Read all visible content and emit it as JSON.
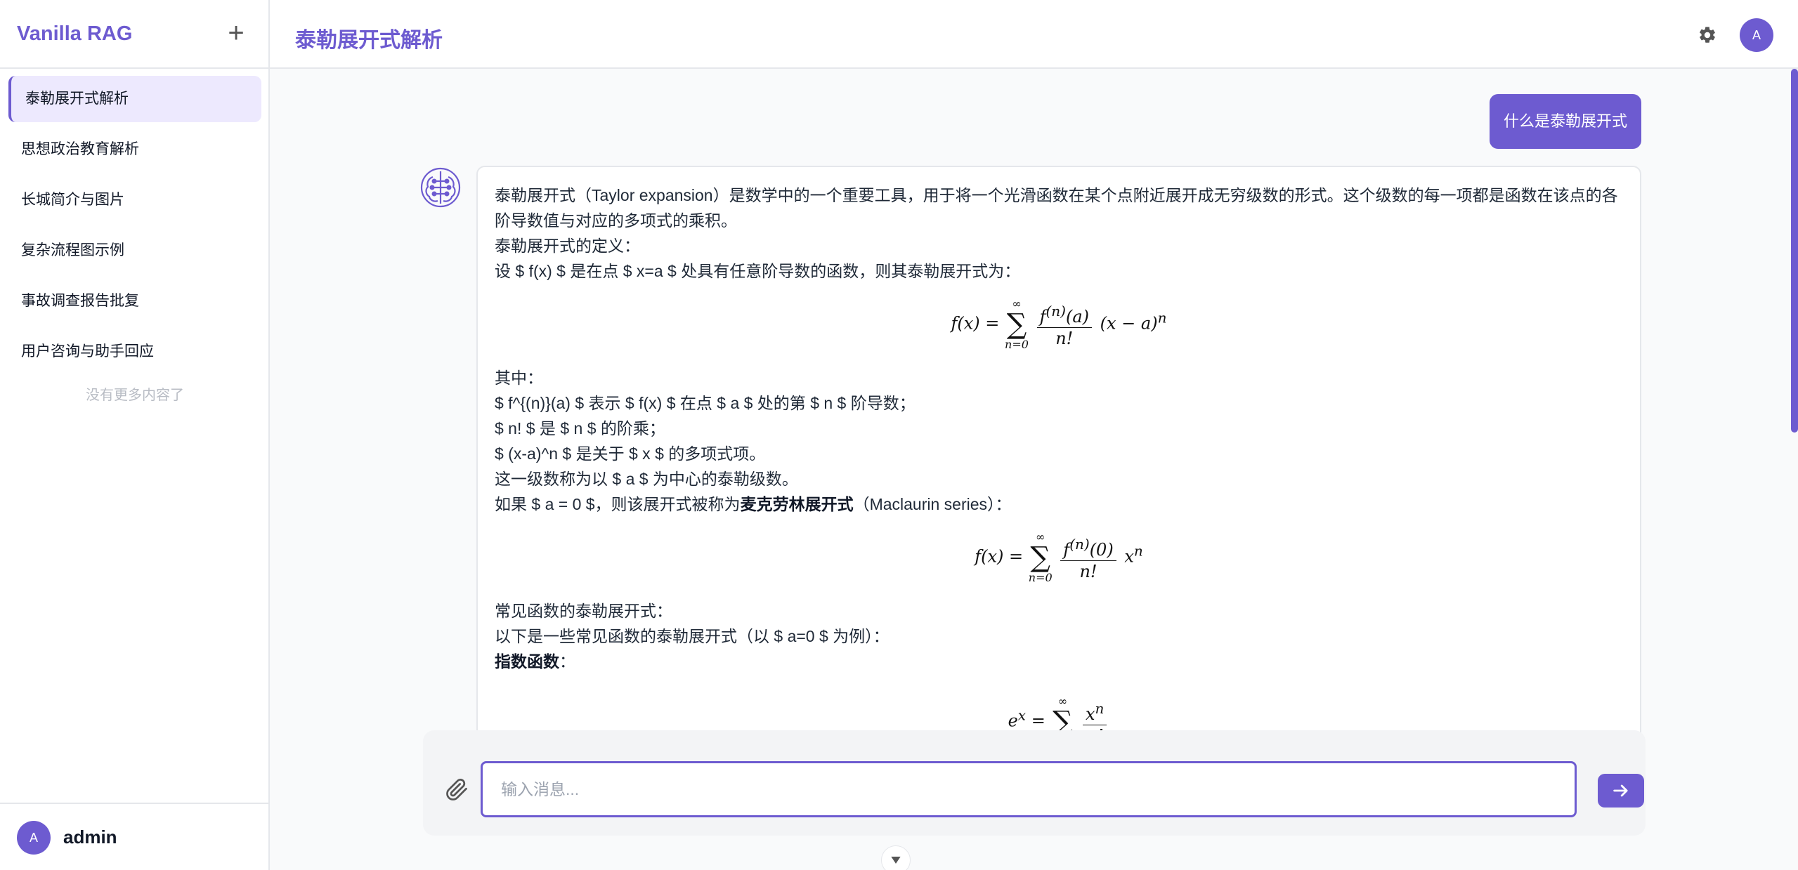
{
  "brand": "Vanilla RAG",
  "new_chat_symbol": "+",
  "sidebar": {
    "items": [
      {
        "label": "泰勒展开式解析",
        "active": true
      },
      {
        "label": "思想政治教育解析"
      },
      {
        "label": "长城简介与图片"
      },
      {
        "label": "复杂流程图示例"
      },
      {
        "label": "事故调查报告批复"
      },
      {
        "label": "用户咨询与助手回应"
      }
    ],
    "no_more": "没有更多内容了"
  },
  "user": {
    "avatar_initial": "A",
    "name": "admin"
  },
  "header": {
    "title": "泰勒展开式解析",
    "avatar_initial": "A"
  },
  "chat": {
    "user_message": "什么是泰勒展开式",
    "bot": {
      "intro": "泰勒展开式（Taylor expansion）是数学中的一个重要工具，用于将一个光滑函数在某个点附近展开成无穷级数的形式。这个级数的每一项都是函数在该点的各阶导数值与对应的多项式的乘积。",
      "def_heading": "泰勒展开式的定义：",
      "def_text": "设 $ f(x) $ 是在点 $ x=a $ 处具有任意阶导数的函数，则其泰勒展开式为：",
      "where": "其中：",
      "b1": "$ f^{(n)}(a) $ 表示 $ f(x) $ 在点 $ a $ 处的第 $ n $ 阶导数；",
      "b2": "$ n! $ 是 $ n $ 的阶乘；",
      "b3": "$ (x-a)^n $ 是关于 $ x $ 的多项式项。",
      "series_text": "这一级数称为以 $ a $ 为中心的泰勒级数。",
      "maclaurin_pre": "如果 $ a = 0 $，则该展开式被称为",
      "maclaurin_bold": "麦克劳林展开式",
      "maclaurin_post": "（Maclaurin series）：",
      "common_heading": "常见函数的泰勒展开式：",
      "common_text": "以下是一些常见函数的泰勒展开式（以 $ a=0 $ 为例）：",
      "exp_heading": "指数函数",
      "exp_colon": "："
    }
  },
  "composer": {
    "placeholder": "输入消息..."
  },
  "colors": {
    "accent": "#6d5bd0",
    "accent_light": "#ede9fe"
  },
  "icons": {
    "new_chat": "plus-icon",
    "settings": "gear-icon",
    "attach": "paperclip-icon",
    "send": "arrow-right-icon",
    "scroll": "chevron-down-icon",
    "bot": "brain-icon"
  }
}
